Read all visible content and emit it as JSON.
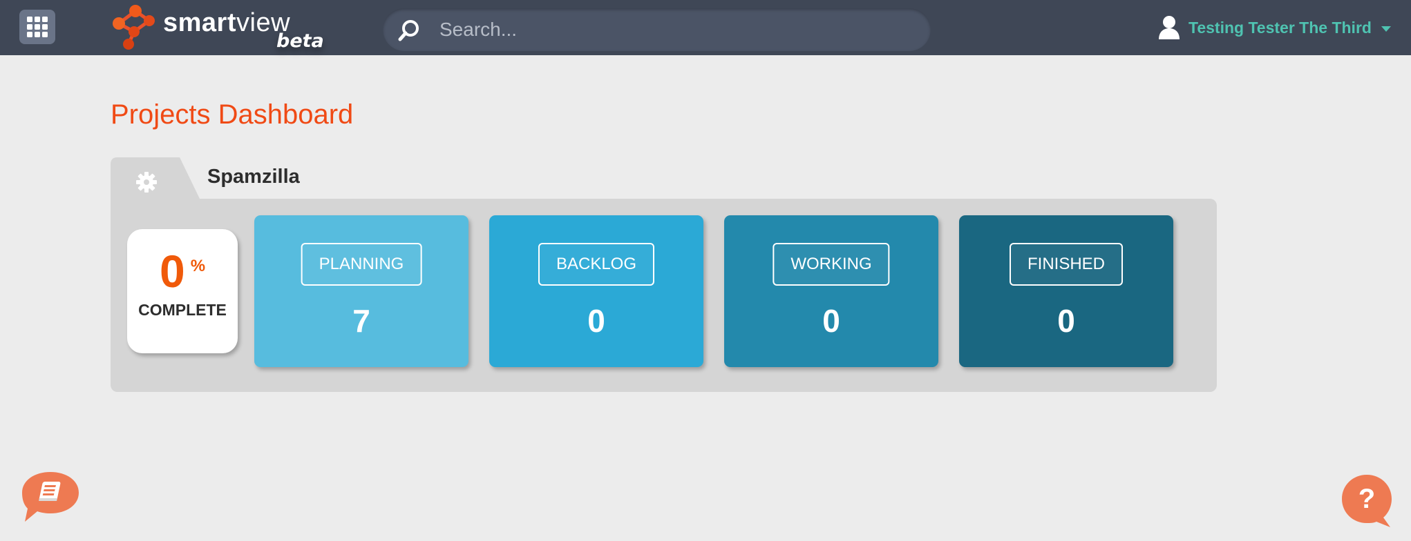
{
  "header": {
    "brand": {
      "name_light": "smart",
      "name_rest": "view",
      "tag": "beta"
    },
    "search": {
      "placeholder": "Search..."
    },
    "user": {
      "name": "Testing Tester The Third"
    }
  },
  "page": {
    "title": "Projects Dashboard"
  },
  "project": {
    "name": "Spamzilla",
    "completion": {
      "value": "0",
      "unit": "%",
      "label": "COMPLETE"
    },
    "stages": [
      {
        "label": "PLANNING",
        "count": "7",
        "color": "#57bcde"
      },
      {
        "label": "BACKLOG",
        "count": "0",
        "color": "#2ba9d6"
      },
      {
        "label": "WORKING",
        "count": "0",
        "color": "#2389ac"
      },
      {
        "label": "FINISHED",
        "count": "0",
        "color": "#1a6781"
      }
    ]
  },
  "colors": {
    "topbar": "#3f4756",
    "accent_orange": "#f04a15",
    "user_teal": "#4fc3b1",
    "fab_orange": "#ee7a52"
  },
  "icons": [
    "apps-grid-icon",
    "smartview-logo",
    "search-icon",
    "user-icon",
    "chevron-down-icon",
    "gear-icon",
    "book-chat-icon",
    "question-chat-icon"
  ]
}
